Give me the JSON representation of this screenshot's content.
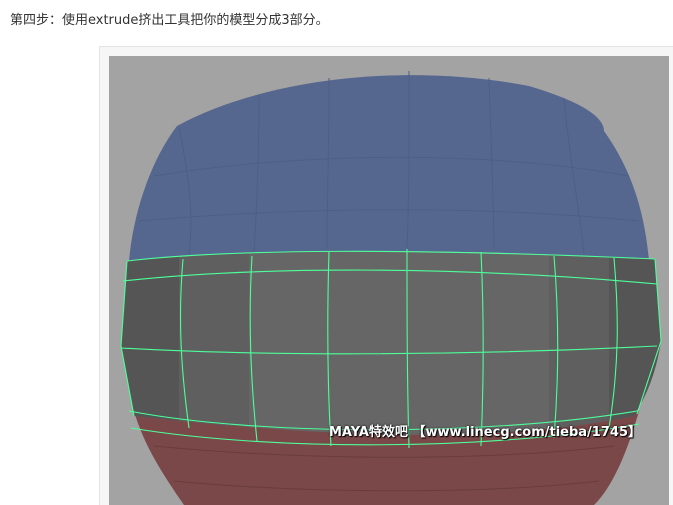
{
  "article": {
    "caption": "第四步：使用extrude挤出工具把你的模型分成3部分。"
  },
  "viewport": {
    "background_color": "#a3a3a3",
    "top_section_color": "#56678f",
    "middle_section_color": "#666666",
    "bottom_section_color": "#7a4848",
    "wire_color": "#4dff9a",
    "watermark": "MAYA特效吧 【www.linecg.com/tieba/1745】"
  }
}
